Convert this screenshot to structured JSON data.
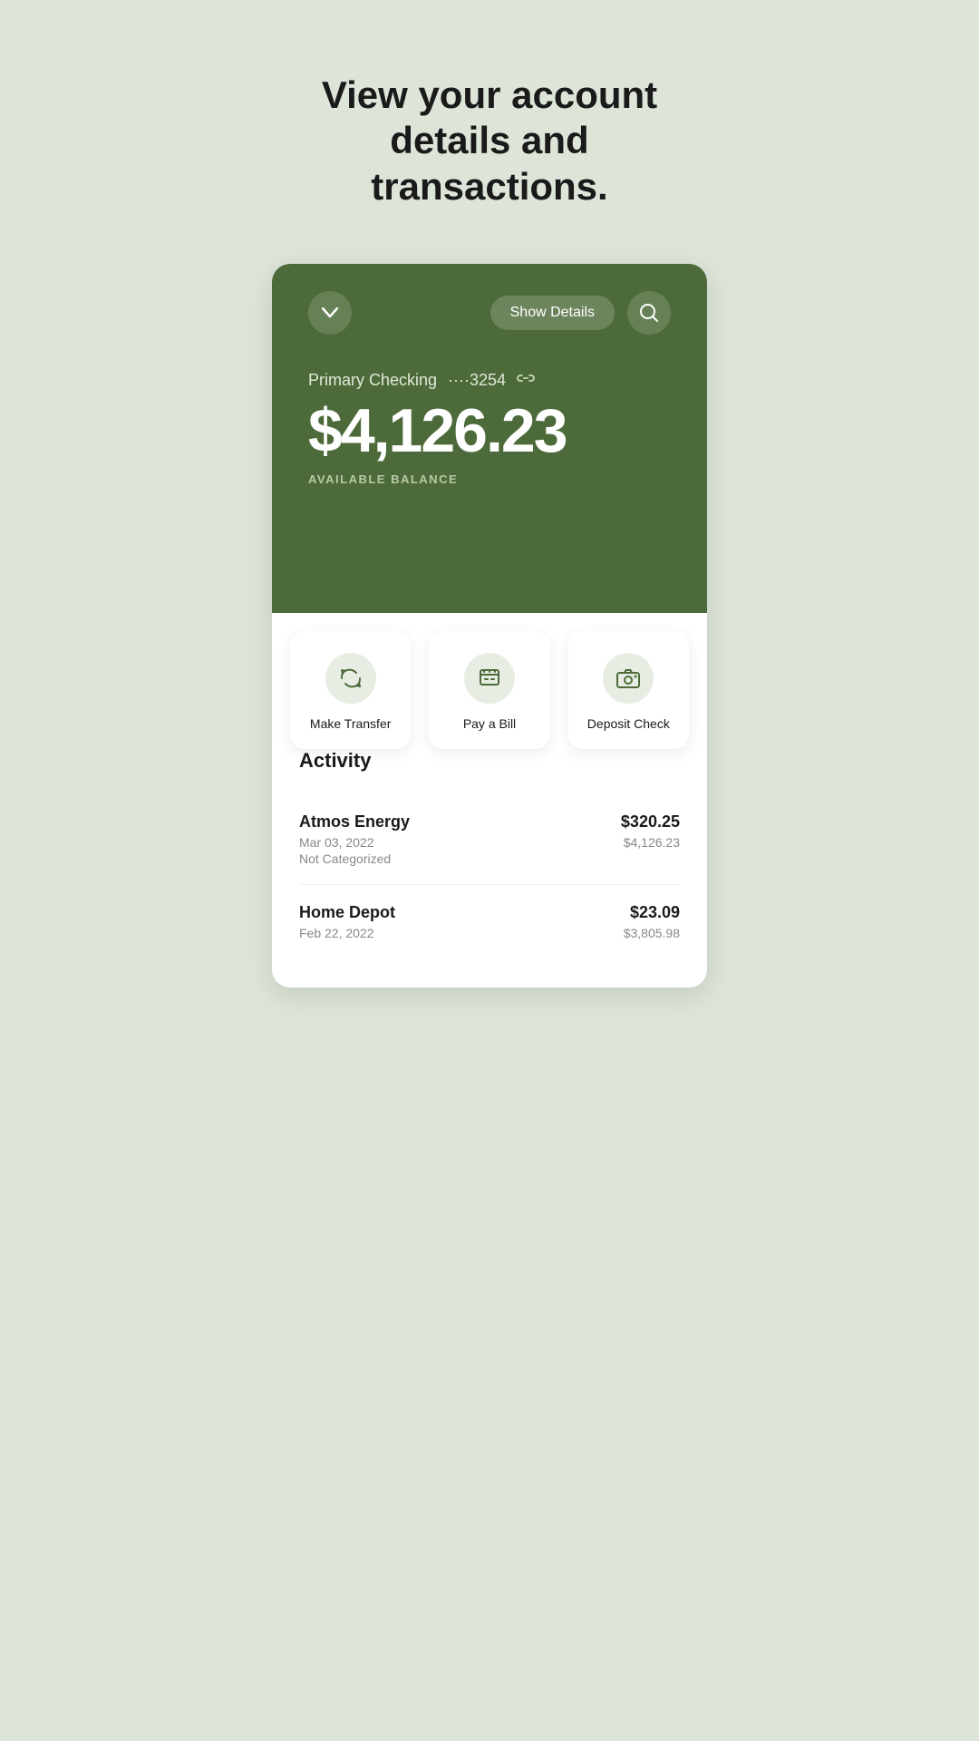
{
  "header": {
    "title": "View your account details and transactions."
  },
  "card": {
    "chevron_label": "▾",
    "show_details_label": "Show Details",
    "search_icon": "🔍",
    "account_name": "Primary Checking",
    "account_number": "····3254",
    "balance": "$4,126.23",
    "balance_label": "AVAILABLE BALANCE"
  },
  "actions": [
    {
      "id": "make-transfer",
      "label": "Make Transfer",
      "icon": "transfer"
    },
    {
      "id": "pay-bill",
      "label": "Pay a Bill",
      "icon": "bill"
    },
    {
      "id": "deposit-check",
      "label": "Deposit Check",
      "icon": "camera"
    }
  ],
  "activity": {
    "title": "Activity",
    "transactions": [
      {
        "merchant": "Atmos Energy",
        "date": "Mar 03, 2022",
        "category": "Not Categorized",
        "amount": "$320.25",
        "balance": "$4,126.23"
      },
      {
        "merchant": "Home Depot",
        "date": "Feb 22, 2022",
        "category": "",
        "amount": "$23.09",
        "balance": "$3,805.98"
      }
    ]
  }
}
